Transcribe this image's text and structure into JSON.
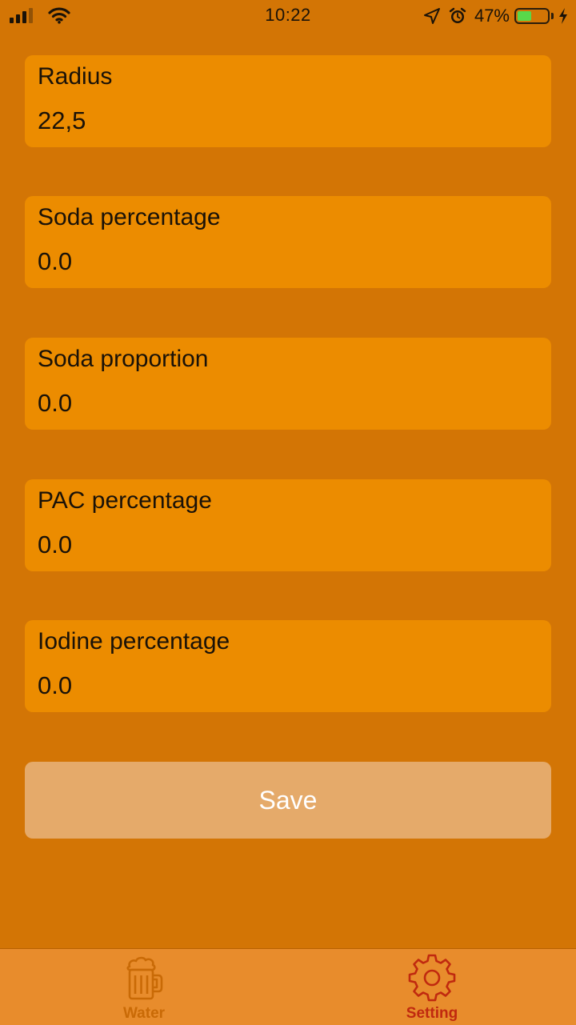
{
  "status_bar": {
    "time": "10:22",
    "battery_percent": "47%",
    "battery_level": 0.47,
    "icons": [
      "signal-icon",
      "wifi-icon",
      "location-arrow-icon",
      "alarm-icon",
      "battery-icon",
      "charging-bolt-icon"
    ]
  },
  "fields": [
    {
      "label": "Radius",
      "value": "22,5"
    },
    {
      "label": "Soda percentage",
      "value": "0.0"
    },
    {
      "label": "Soda proportion",
      "value": "0.0"
    },
    {
      "label": "PAC percentage",
      "value": "0.0"
    },
    {
      "label": "Iodine percentage",
      "value": "0.0"
    }
  ],
  "save_button": {
    "label": "Save"
  },
  "tab_bar": {
    "tabs": [
      {
        "label": "Water",
        "icon": "beer-mug-icon",
        "selected": false
      },
      {
        "label": "Setting",
        "icon": "gear-icon",
        "selected": true
      }
    ]
  },
  "colors": {
    "background": "#D37505",
    "card": "#EC8C00",
    "save_button": "#E5AA6A",
    "tab_bar": "#E88C2C",
    "tab_inactive": "#C96A06",
    "tab_active": "#C0290F",
    "battery_fill": "#59D84A"
  }
}
